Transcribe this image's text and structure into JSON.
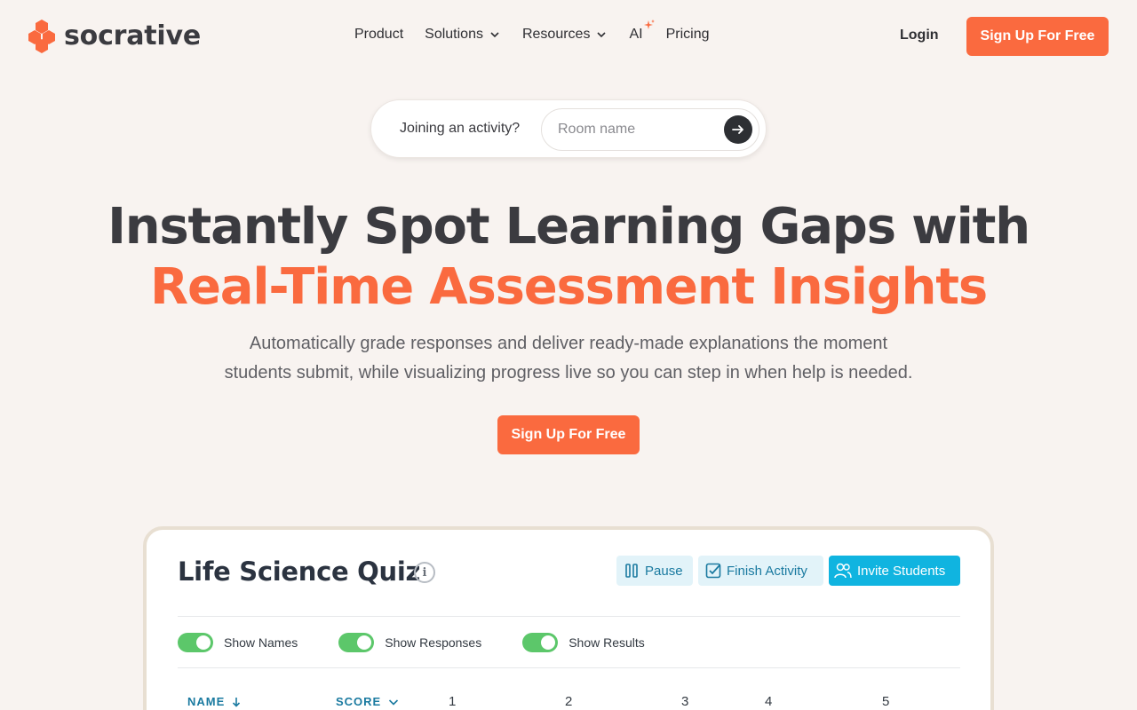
{
  "brand": {
    "name": "socrative",
    "accent": "#fa6a3f"
  },
  "nav": {
    "items": [
      {
        "label": "Product"
      },
      {
        "label": "Solutions"
      },
      {
        "label": "Resources"
      },
      {
        "label": "AI"
      },
      {
        "label": "Pricing"
      }
    ],
    "login": "Login",
    "signup": "Sign Up For Free"
  },
  "join": {
    "label": "Joining an activity?",
    "placeholder": "Room name",
    "value": ""
  },
  "hero": {
    "title_line1": "Instantly Spot Learning Gaps with",
    "title_line2": "Real-Time Assessment Insights",
    "subtitle_line1": "Automatically grade responses and deliver ready-made explanations the moment",
    "subtitle_line2": "students submit, while visualizing progress live so you can step in when help is needed.",
    "cta": "Sign Up For Free"
  },
  "dashboard": {
    "title": "Life Science Quiz",
    "info": "i",
    "buttons": {
      "pause": "Pause",
      "finish": "Finish Activity",
      "invite": "Invite Students"
    },
    "toggles": [
      {
        "label": "Show Names",
        "on": true
      },
      {
        "label": "Show Responses",
        "on": true
      },
      {
        "label": "Show Results",
        "on": true
      }
    ],
    "columns": {
      "name": "NAME",
      "score": "SCORE",
      "questions": [
        "1",
        "2",
        "3",
        "4",
        "5"
      ]
    }
  }
}
